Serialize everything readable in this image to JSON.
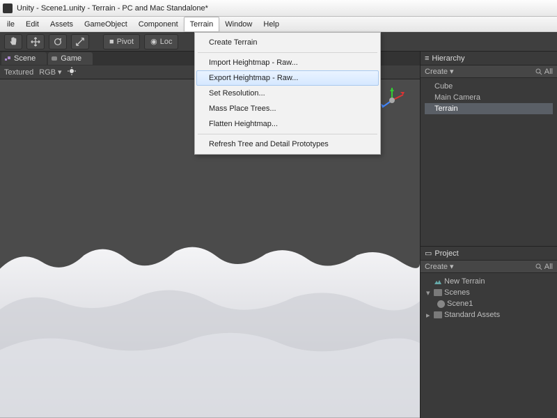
{
  "window": {
    "title": "Unity - Scene1.unity - Terrain - PC and Mac Standalone*"
  },
  "menu": {
    "items": [
      "ile",
      "Edit",
      "Assets",
      "GameObject",
      "Component",
      "Terrain",
      "Window",
      "Help"
    ],
    "active": "Terrain"
  },
  "toolbar": {
    "pivot_label": "Pivot",
    "local_label": "Loc"
  },
  "scene_tabs": {
    "scene": "Scene",
    "game": "Game"
  },
  "scene_toolbar": {
    "shading": "Textured",
    "draw_mode": "RGB"
  },
  "play_controls": {
    "play": "▶",
    "pause": "▮▮",
    "step": "▶▮"
  },
  "dropdown": {
    "items": [
      "Create Terrain",
      "Import Heightmap - Raw...",
      "Export Heightmap - Raw...",
      "Set Resolution...",
      "Mass Place Trees...",
      "Flatten Heightmap...",
      "Refresh Tree and Detail Prototypes"
    ],
    "highlighted": "Export Heightmap - Raw..."
  },
  "hierarchy": {
    "title": "Hierarchy",
    "create_label": "Create",
    "search_icon": "search",
    "search_label": "All",
    "items": [
      "Cube",
      "Main Camera",
      "Terrain"
    ],
    "selected": "Terrain"
  },
  "project": {
    "title": "Project",
    "create_label": "Create",
    "search_icon": "search",
    "search_label": "All",
    "tree": [
      {
        "label": "New Terrain",
        "kind": "asset",
        "depth": 0
      },
      {
        "label": "Scenes",
        "kind": "folder",
        "depth": 0,
        "expanded": true
      },
      {
        "label": "Scene1",
        "kind": "scene",
        "depth": 1
      },
      {
        "label": "Standard Assets",
        "kind": "folder",
        "depth": 0,
        "expanded": false
      }
    ]
  }
}
